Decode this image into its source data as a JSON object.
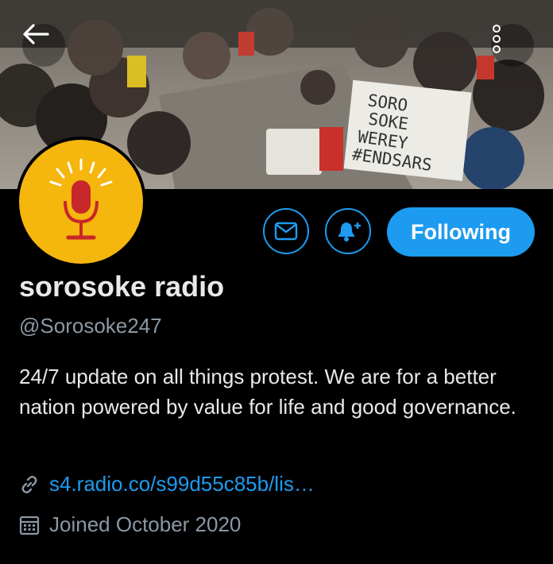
{
  "header": {
    "back_icon": "arrow-left-icon",
    "more_icon": "vertical-dots-icon",
    "banner_sign_lines": [
      "SORO",
      "SOKE",
      "WEREY",
      "#ENDSARS"
    ]
  },
  "profile": {
    "avatar_icon": "microphone-icon",
    "display_name": "sorosoke radio",
    "handle": "@Sorosoke247",
    "bio": "24/7 update on all things protest. We are for a better nation powered by value for life and good governance.",
    "link": "s4.radio.co/s99d55c85b/lis…",
    "joined": "Joined October 2020"
  },
  "actions": {
    "message_icon": "envelope-icon",
    "notify_icon": "bell-plus-icon",
    "follow_label": "Following"
  },
  "colors": {
    "accent": "#1d9bf0",
    "avatar_bg": "#f5b60d",
    "background": "#000000",
    "secondary_text": "#8b98a5"
  }
}
